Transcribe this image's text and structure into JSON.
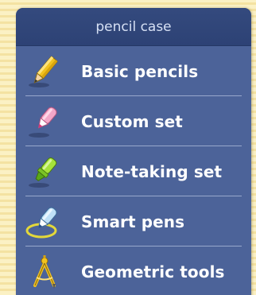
{
  "panel": {
    "title": "pencil case",
    "items": [
      {
        "label": "Basic pencils",
        "icon": "yellow-pencil-icon"
      },
      {
        "label": "Custom set",
        "icon": "pink-pencil-icon"
      },
      {
        "label": "Note-taking set",
        "icon": "green-highlighter-icon"
      },
      {
        "label": "Smart pens",
        "icon": "smart-pen-icon"
      },
      {
        "label": "Geometric tools",
        "icon": "compass-icon"
      }
    ]
  },
  "colors": {
    "background": "#fbf1c4",
    "panel": "#4c6399",
    "header": "#2d4275"
  }
}
